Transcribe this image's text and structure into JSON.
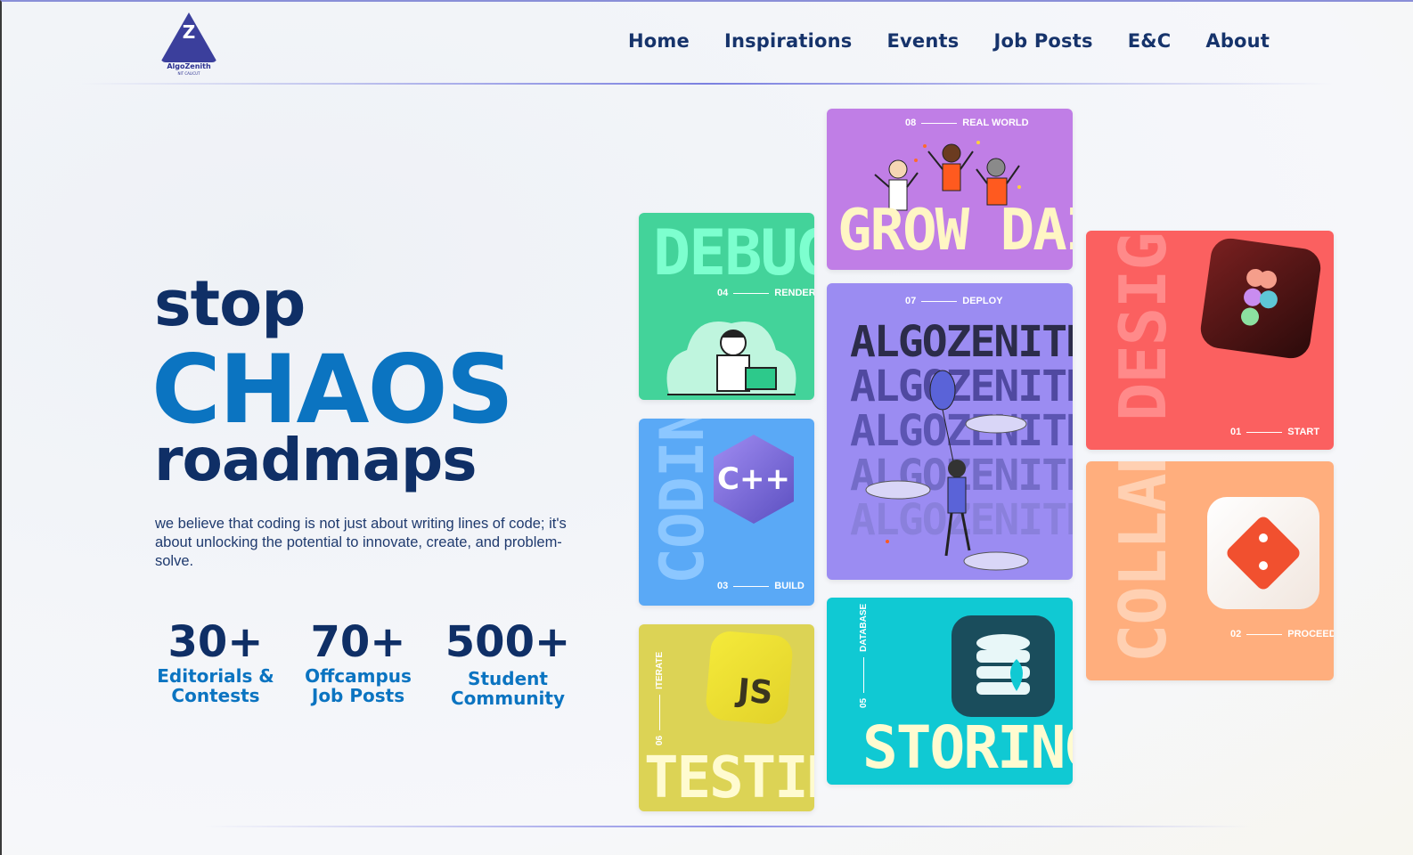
{
  "brand": {
    "name": "AlgoZenith",
    "sub": "NIT CALICUT",
    "logo_letter": "Z"
  },
  "nav": {
    "items": [
      "Home",
      "Inspirations",
      "Events",
      "Job Posts",
      "E&C",
      "About"
    ]
  },
  "hero": {
    "line1": "stop",
    "line2": "CHAOS",
    "line3": "roadmaps",
    "description": "we believe that coding is not just about writing lines of code; it's about unlocking the potential to innovate, create, and problem-solve."
  },
  "stats": [
    {
      "value": "30+",
      "label_1": "Editorials &",
      "label_2": "Contests"
    },
    {
      "value": "70+",
      "label_1": "Offcampus",
      "label_2": "Job Posts"
    },
    {
      "value": "500+",
      "label_1": "Student",
      "label_2": "Community"
    }
  ],
  "cards": {
    "grow": {
      "title": "GROW DAILY",
      "num": "08",
      "step": "REAL WORLD",
      "color": "#c07ee6"
    },
    "debug": {
      "title": "DEBUG",
      "num": "04",
      "step": "RENDER",
      "color": "#43d39a"
    },
    "algo": {
      "title": "ALGOZENITH",
      "num": "07",
      "step": "DEPLOY",
      "color": "#9b8cf2"
    },
    "design": {
      "title": "DESIGN",
      "num": "01",
      "step": "START",
      "color": "#fb6060"
    },
    "coding": {
      "title": "CODING",
      "num": "03",
      "step": "BUILD",
      "color": "#5aa9f6",
      "icon": "C++"
    },
    "collab": {
      "title": "COLLAB",
      "num": "02",
      "step": "PROCEED",
      "color": "#ffae7d"
    },
    "storing": {
      "title": "STORING",
      "num": "05",
      "step": "DATABASE",
      "color": "#10c9d3"
    },
    "testing": {
      "title": "TESTING",
      "num": "06",
      "step": "ITERATE",
      "color": "#dcd355",
      "icon": "JS"
    }
  }
}
